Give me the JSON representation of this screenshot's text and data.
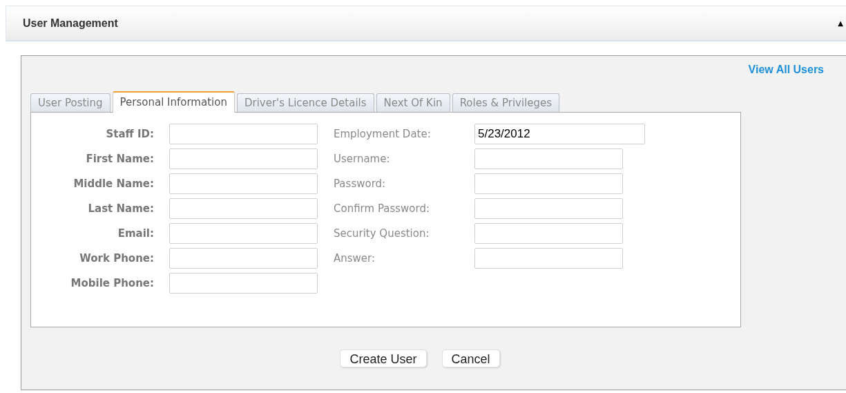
{
  "header": {
    "title": "User Management",
    "toggle": "▲"
  },
  "link": "View All Users",
  "tabs": [
    {
      "label": "User Posting",
      "selected": false
    },
    {
      "label": "Personal Information",
      "selected": true
    },
    {
      "label": "Driver's Licence Details",
      "selected": false
    },
    {
      "label": "Next Of Kin",
      "selected": false
    },
    {
      "label": "Roles & Privileges",
      "selected": false
    }
  ],
  "left_fields": [
    {
      "label": "Staff ID:"
    },
    {
      "label": "First Name:"
    },
    {
      "label": "Middle Name:"
    },
    {
      "label": "Last Name:"
    },
    {
      "label": "Email:"
    },
    {
      "label": "Work Phone:"
    },
    {
      "label": "Mobile Phone:"
    }
  ],
  "right_fields": [
    {
      "label": "Employment Date:",
      "value": "5/23/2012",
      "kind": "date"
    },
    {
      "label": "Username:",
      "kind": "text"
    },
    {
      "label": "Password:",
      "kind": "text"
    },
    {
      "label": "Confirm Password:",
      "kind": "text"
    },
    {
      "label": "Security Question:",
      "kind": "text"
    },
    {
      "label": "Answer:",
      "kind": "text"
    }
  ],
  "buttons": [
    "Create User",
    "Cancel"
  ]
}
